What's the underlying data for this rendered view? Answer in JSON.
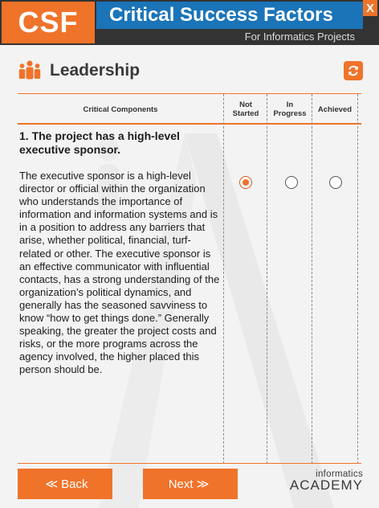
{
  "header": {
    "logo_text": "CSF",
    "title": "Critical Success Factors",
    "subtitle": "For Informatics Projects",
    "close_label": "X"
  },
  "section": {
    "icon": "people-group-icon",
    "title": "Leadership",
    "refresh_icon": "refresh-icon"
  },
  "table": {
    "columns": [
      {
        "label": "Critical Components"
      },
      {
        "label": "Not Started"
      },
      {
        "label": "In Progress"
      },
      {
        "label": "Achieved"
      }
    ],
    "question": {
      "title": "1. The project has a high-level executive sponsor.",
      "body": "The executive sponsor is a high-level director or official  within the organization who understands the importance of information and information systems and is in a position to address any barriers that arise, whether political, financial, turf-related or other. The executive sponsor is an effective communicator with influential contacts, has a strong understanding of the organization’s political dynamics, and generally has the seasoned savviness to know “how to get things done.” Generally speaking, the greater the project costs and risks, or the more programs across the agency involved, the higher placed this person should be.",
      "selected_status": "Not Started"
    }
  },
  "footer": {
    "back_label": "Back",
    "next_label": "Next",
    "brand_top": "informatics",
    "brand_bottom": "ACADEMY"
  },
  "colors": {
    "accent": "#f0732a",
    "header_bg": "#333333",
    "title_band": "#1b74b8"
  }
}
